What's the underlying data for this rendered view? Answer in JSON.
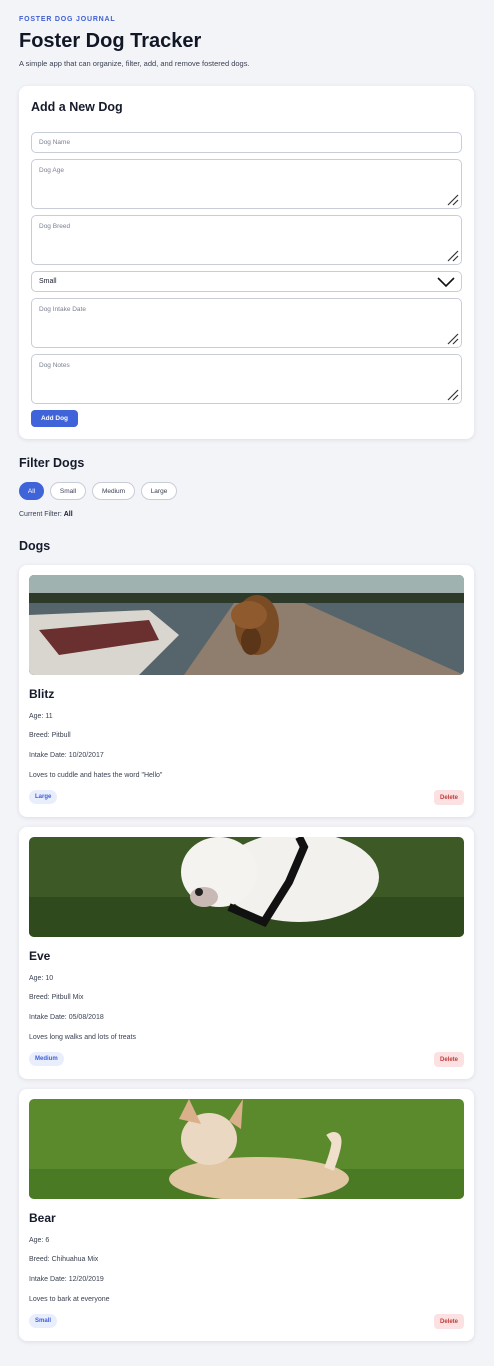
{
  "header": {
    "eyebrow": "FOSTER DOG JOURNAL",
    "title": "Foster Dog Tracker",
    "subtitle": "A simple app that can organize, filter, add, and remove fostered dogs."
  },
  "add_form": {
    "heading": "Add a New Dog",
    "name_placeholder": "Dog Name",
    "age_placeholder": "Dog Age",
    "breed_placeholder": "Dog Breed",
    "size_selected": "Small",
    "intake_placeholder": "Dog Intake Date",
    "notes_placeholder": "Dog Notes",
    "submit_label": "Add Dog"
  },
  "filter": {
    "heading": "Filter Dogs",
    "options": [
      "All",
      "Small",
      "Medium",
      "Large"
    ],
    "active": "All",
    "current_label": "Current Filter:",
    "current_value": "All"
  },
  "dogs_heading": "Dogs",
  "dogs": [
    {
      "name": "Blitz",
      "age": "Age: 11",
      "breed": "Breed: Pitbull",
      "intake": "Intake Date: 10/20/2017",
      "notes": "Loves to cuddle and hates the word \"Hello\"",
      "size": "Large",
      "delete_label": "Delete"
    },
    {
      "name": "Eve",
      "age": "Age: 10",
      "breed": "Breed: Pitbull Mix",
      "intake": "Intake Date: 05/08/2018",
      "notes": "Loves long walks and lots of treats",
      "size": "Medium",
      "delete_label": "Delete"
    },
    {
      "name": "Bear",
      "age": "Age: 6",
      "breed": "Breed: Chihuahua Mix",
      "intake": "Intake Date: 12/20/2019",
      "notes": "Loves to bark at everyone",
      "size": "Small",
      "delete_label": "Delete"
    }
  ],
  "colors": {
    "accent": "#3f63d8",
    "background": "#f3f4f8",
    "delete_bg": "#fbe1e1",
    "delete_text": "#c23b3b",
    "badge_bg": "#e9eefc"
  }
}
